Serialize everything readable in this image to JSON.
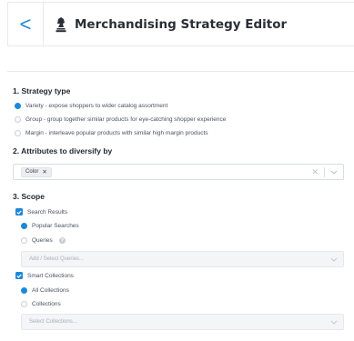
{
  "header": {
    "back_label": "<",
    "title": "Merchandising Strategy Editor"
  },
  "strategy": {
    "heading": "1. Strategy type",
    "options": [
      {
        "label": "Variety - expose shoppers to wider catalog assortment",
        "selected": true
      },
      {
        "label": "Group - group together similar products for eye-catching shopper experience",
        "selected": false
      },
      {
        "label": "Margin - interleave popular products with similar high margin products",
        "selected": false
      }
    ]
  },
  "attributes": {
    "heading": "2. Attributes to diversify by",
    "chip": "Color"
  },
  "scope": {
    "heading": "3. Scope",
    "search_results": {
      "label": "Search Results",
      "checked": true,
      "options": [
        {
          "label": "Popular Searches",
          "selected": true
        },
        {
          "label": "Queries",
          "selected": false
        }
      ],
      "placeholder": "Add / Select Queries..."
    },
    "smart_collections": {
      "label": "Smart Collections",
      "checked": true,
      "options": [
        {
          "label": "All Collections",
          "selected": true
        },
        {
          "label": "Collections",
          "selected": false
        }
      ],
      "placeholder": "Select Collections..."
    }
  },
  "colors": {
    "accent": "#1e88d9",
    "border": "#e7e9ee",
    "text": "#2b3340"
  }
}
